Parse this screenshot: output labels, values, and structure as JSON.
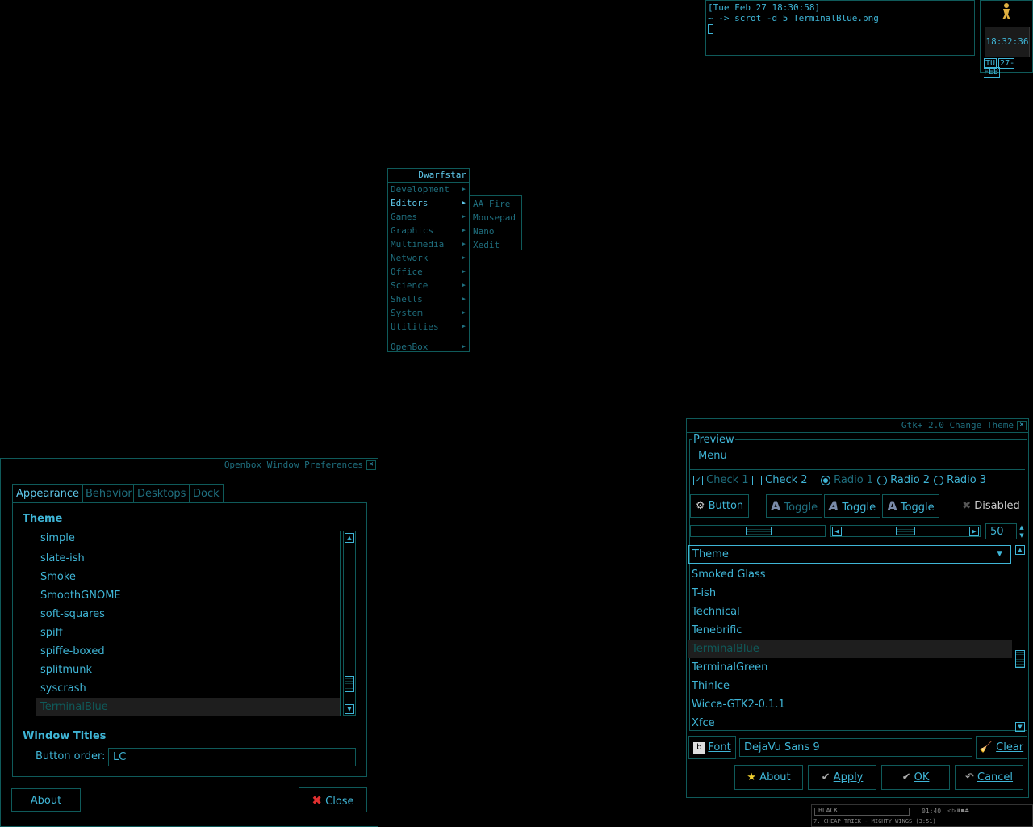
{
  "terminal": {
    "line1": "[Tue Feb 27 18:30:58]",
    "line2": "~ -> scrot -d 5 TerminalBlue.png"
  },
  "dock": {
    "time": "18:32:36",
    "day": "TU",
    "date": "27-FEB"
  },
  "menu": {
    "title": "Dwarfstar",
    "items": [
      "Development",
      "Editors",
      "Games",
      "Graphics",
      "Multimedia",
      "Network",
      "Office",
      "Science",
      "Shells",
      "System",
      "Utilities"
    ],
    "openbox": "OpenBox",
    "submenu": [
      "AA Fire",
      "Mousepad",
      "Nano",
      "Xedit"
    ]
  },
  "openbox_prefs": {
    "title": "Openbox Window Preferences",
    "tabs": [
      "Appearance",
      "Behavior",
      "Desktops",
      "Dock"
    ],
    "theme_header": "Theme",
    "themes": [
      "simple",
      "slate-ish",
      "Smoke",
      "SmoothGNOME",
      "soft-squares",
      "spiff",
      "spiffe-boxed",
      "splitmunk",
      "syscrash",
      "TerminalBlue"
    ],
    "selected_theme": "TerminalBlue",
    "window_titles_header": "Window Titles",
    "button_order_label": "Button order:",
    "button_order_value": "LC",
    "about_label": "About",
    "close_label": "Close"
  },
  "gtk_theme": {
    "title": "Gtk+ 2.0 Change Theme",
    "preview_label": "Preview",
    "menu_label": "Menu",
    "check1": "Check 1",
    "check2": "Check 2",
    "radio1": "Radio 1",
    "radio2": "Radio 2",
    "radio3": "Radio 3",
    "button_label": "Button",
    "toggle_label": "Toggle",
    "disabled_label": "Disabled",
    "spin_value": "50",
    "combo_label": "Theme",
    "themes": [
      "Smoked Glass",
      "T-ish",
      "Technical",
      "Tenebrific",
      "TerminalBlue",
      "TerminalGreen",
      "ThinIce",
      "Wicca-GTK2-0.1.1",
      "Xfce"
    ],
    "selected_theme": "TerminalBlue",
    "font_button": "Font",
    "font_value": "DejaVu Sans 9",
    "clear_label": "Clear",
    "about_label": "About",
    "apply_label": "Apply",
    "ok_label": "OK",
    "cancel_label": "Cancel"
  },
  "player": {
    "name": "BLACK",
    "time": "01:40",
    "track": "7. CHEAP TRICK - MIGHTY WINGS (3:51)"
  },
  "colors": {
    "accent": "#3fb5d6",
    "border": "#0f5a5a",
    "dim": "#1f6f7f",
    "background": "#000000"
  }
}
